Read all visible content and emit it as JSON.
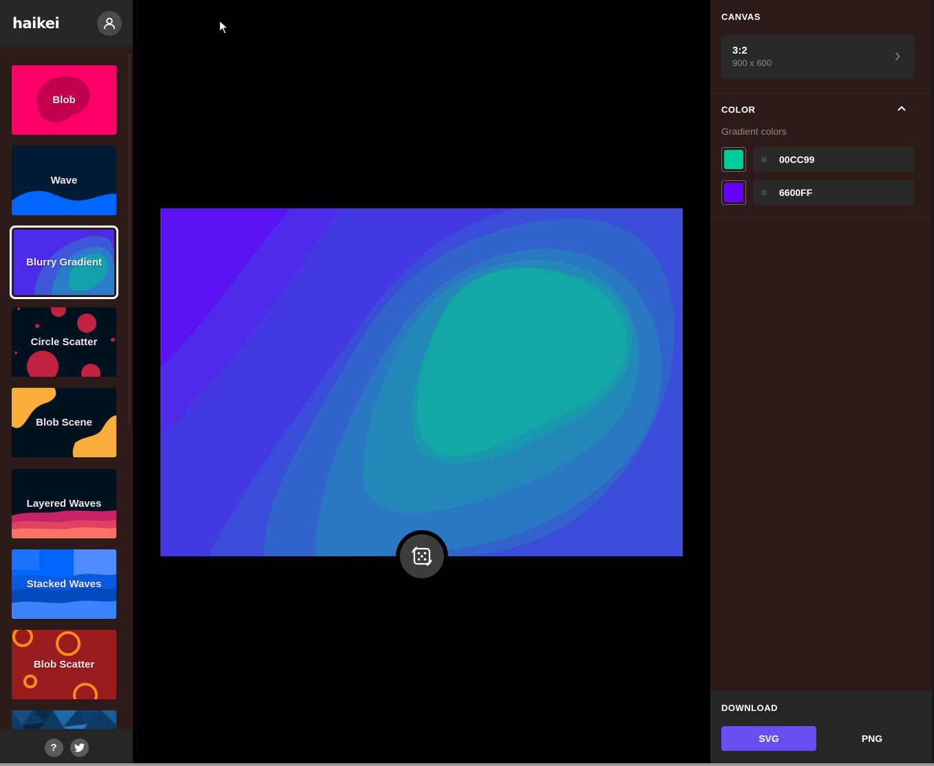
{
  "app": {
    "logo": "haikei"
  },
  "sidebar": {
    "items": [
      {
        "label": "Blob"
      },
      {
        "label": "Wave"
      },
      {
        "label": "Blurry Gradient"
      },
      {
        "label": "Circle Scatter"
      },
      {
        "label": "Blob Scene"
      },
      {
        "label": "Layered Waves"
      },
      {
        "label": "Stacked Waves"
      },
      {
        "label": "Blob Scatter"
      },
      {
        "label": ""
      }
    ],
    "selected": "Blurry Gradient",
    "footer": {
      "help": "?"
    }
  },
  "panel": {
    "canvas": {
      "title": "CANVAS",
      "ratio": "3:2",
      "size": "900 x 600"
    },
    "color": {
      "title": "COLOR",
      "gradient_label": "Gradient colors",
      "colors": [
        {
          "hash": "#",
          "hex": "00CC99",
          "swatch": "#00cc99"
        },
        {
          "hash": "#",
          "hex": "6600FF",
          "swatch": "#6600ff"
        }
      ]
    },
    "download": {
      "title": "DOWNLOAD",
      "svg_label": "SVG",
      "png_label": "PNG"
    }
  },
  "icons": {
    "user": "user-icon",
    "help": "help-icon",
    "twitter": "twitter-icon",
    "dice": "dice-icon",
    "chevron_right": "chevron-right-icon",
    "chevron_up": "chevron-up-icon"
  }
}
